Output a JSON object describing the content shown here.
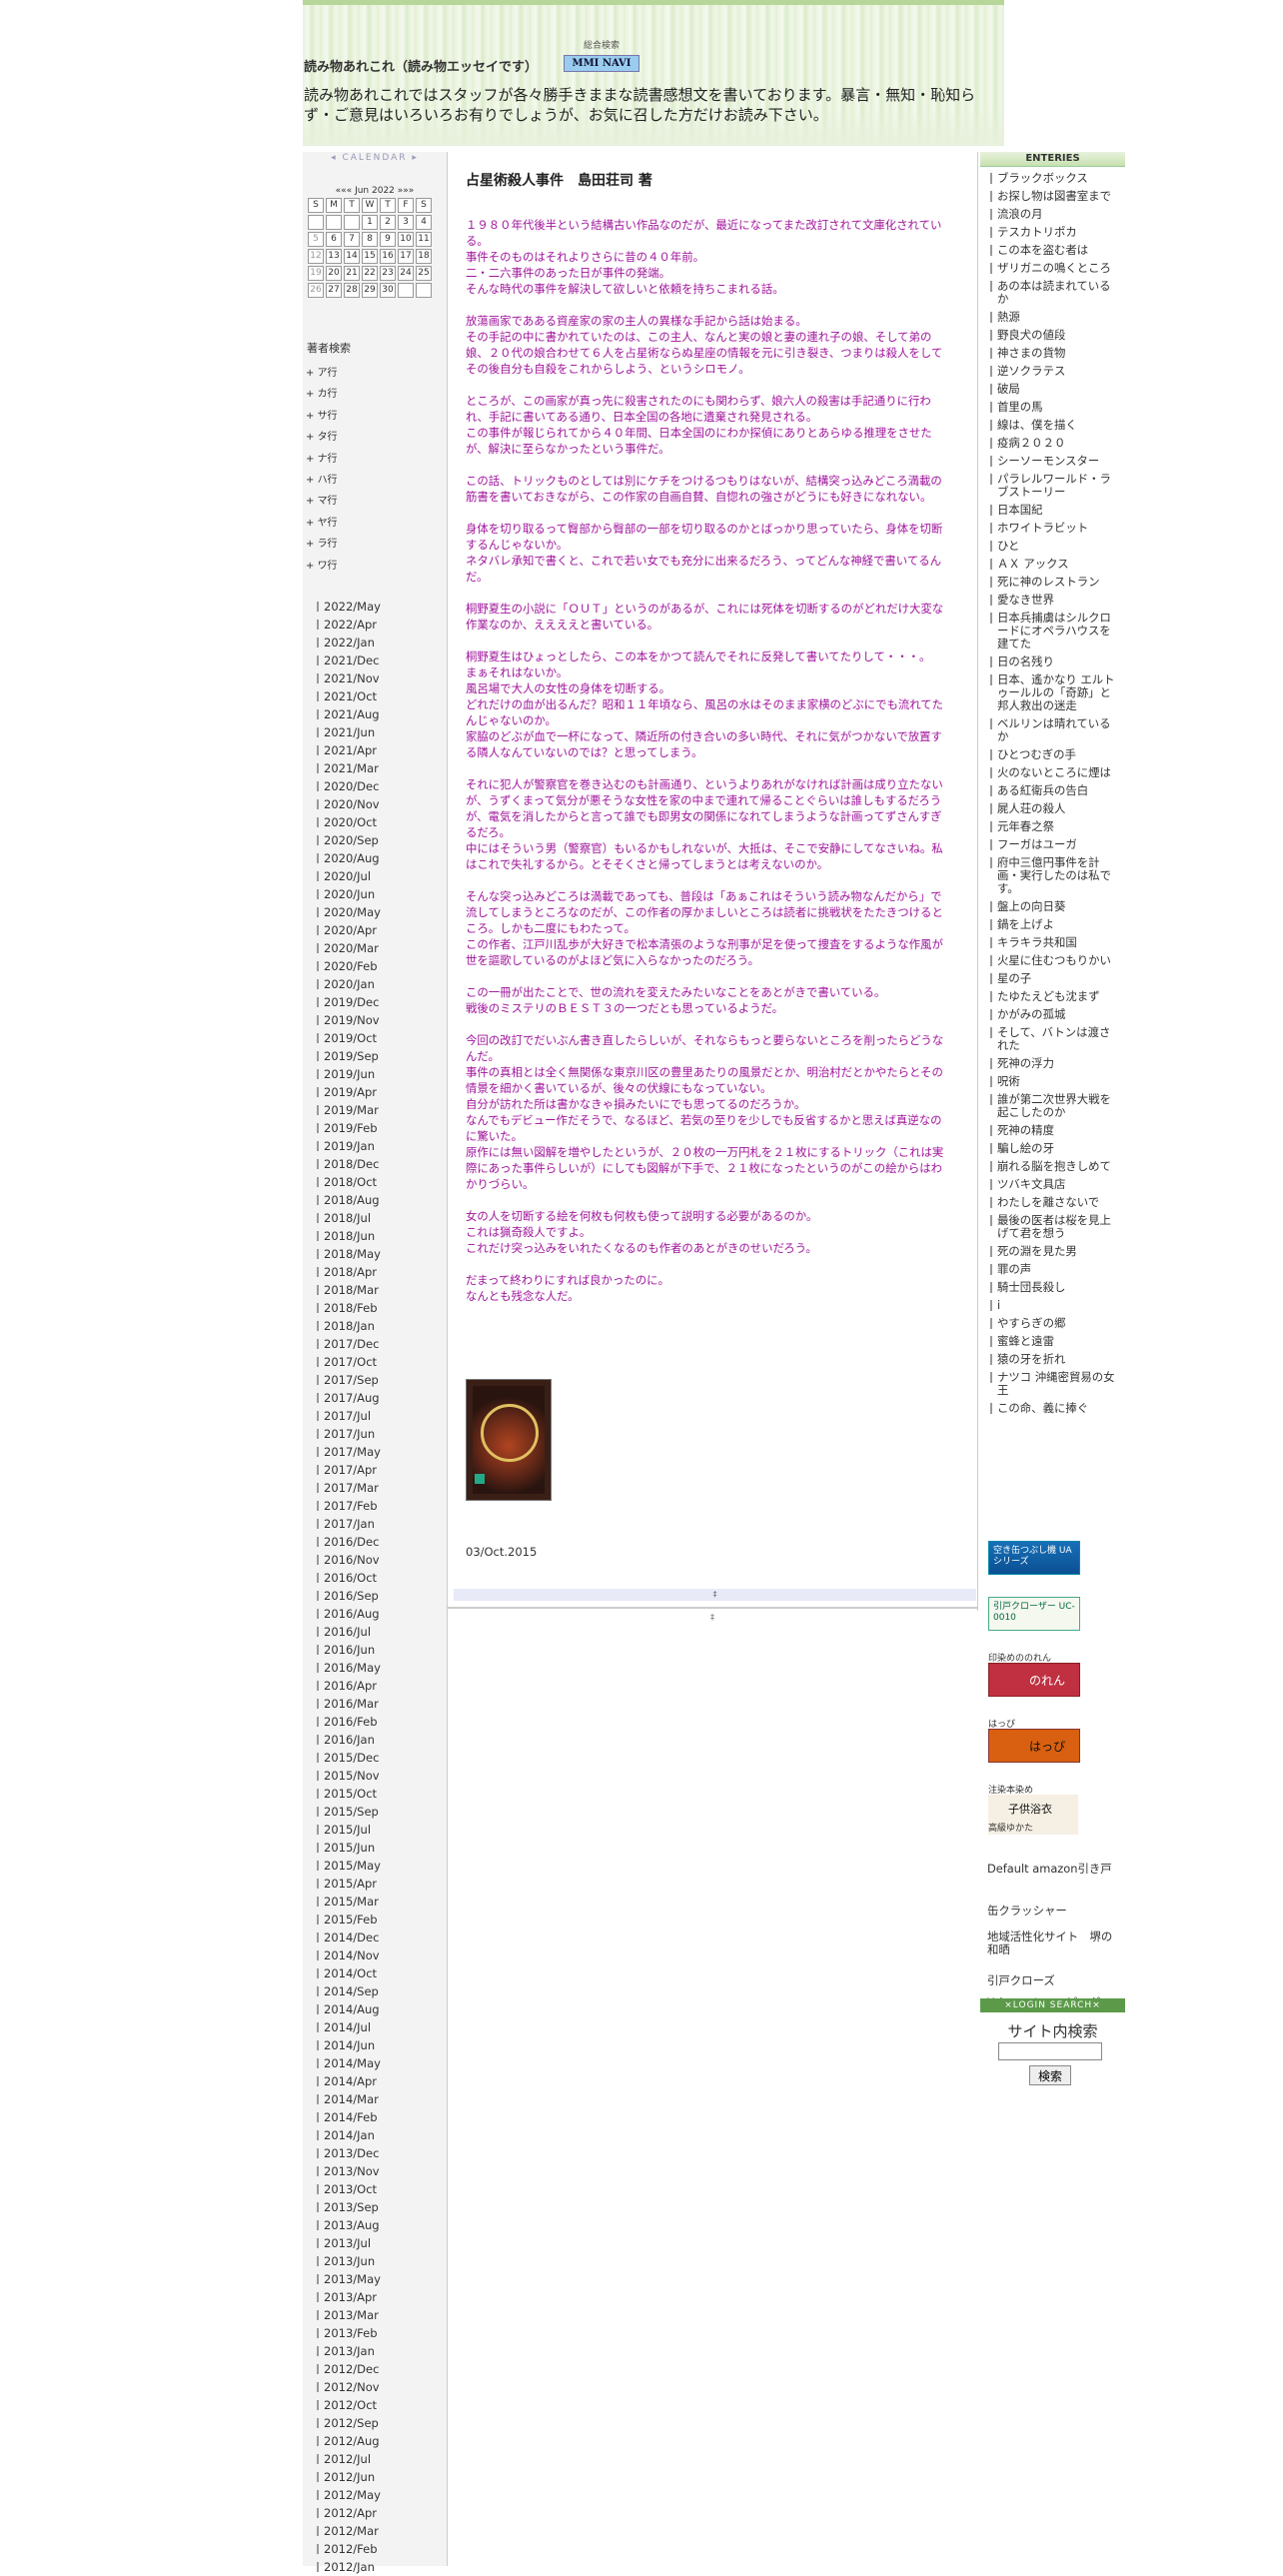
{
  "header": {
    "site_title": "読み物あれこれ（読み物エッセイです）",
    "nav_label": "総合検索",
    "nav_button": "MMI NAVI",
    "description": "読み物あれこれではスタッフが各々勝手きままな読書感想文を書いております。暴言・無知・恥知らず・ご意見はいろいろお有りでしょうが、お気に召した方だけお読み下さい。"
  },
  "calendar": {
    "heading": "CALENDAR",
    "month_label": "Jun 2022",
    "weekdays": [
      "S",
      "M",
      "T",
      "W",
      "T",
      "F",
      "S"
    ],
    "weeks": [
      [
        "",
        "",
        "",
        "1",
        "2",
        "3",
        "4"
      ],
      [
        "5",
        "6",
        "7",
        "8",
        "9",
        "10",
        "11"
      ],
      [
        "12",
        "13",
        "14",
        "15",
        "16",
        "17",
        "18"
      ],
      [
        "19",
        "20",
        "21",
        "22",
        "23",
        "24",
        "25"
      ],
      [
        "26",
        "27",
        "28",
        "29",
        "30",
        "",
        ""
      ]
    ]
  },
  "authors": {
    "heading": "著者検索",
    "groups": [
      "ア行",
      "カ行",
      "サ行",
      "タ行",
      "ナ行",
      "ハ行",
      "マ行",
      "ヤ行",
      "ラ行",
      "ワ行"
    ]
  },
  "archive": [
    "2022/May",
    "2022/Apr",
    "2022/Jan",
    "2021/Dec",
    "2021/Nov",
    "2021/Oct",
    "2021/Aug",
    "2021/Jun",
    "2021/Apr",
    "2021/Mar",
    "2020/Dec",
    "2020/Nov",
    "2020/Oct",
    "2020/Sep",
    "2020/Aug",
    "2020/Jul",
    "2020/Jun",
    "2020/May",
    "2020/Apr",
    "2020/Mar",
    "2020/Feb",
    "2020/Jan",
    "2019/Dec",
    "2019/Nov",
    "2019/Oct",
    "2019/Sep",
    "2019/Jun",
    "2019/Apr",
    "2019/Mar",
    "2019/Feb",
    "2019/Jan",
    "2018/Dec",
    "2018/Oct",
    "2018/Aug",
    "2018/Jul",
    "2018/Jun",
    "2018/May",
    "2018/Apr",
    "2018/Mar",
    "2018/Feb",
    "2018/Jan",
    "2017/Dec",
    "2017/Oct",
    "2017/Sep",
    "2017/Aug",
    "2017/Jul",
    "2017/Jun",
    "2017/May",
    "2017/Apr",
    "2017/Mar",
    "2017/Feb",
    "2017/Jan",
    "2016/Dec",
    "2016/Nov",
    "2016/Oct",
    "2016/Sep",
    "2016/Aug",
    "2016/Jul",
    "2016/Jun",
    "2016/May",
    "2016/Apr",
    "2016/Mar",
    "2016/Feb",
    "2016/Jan",
    "2015/Dec",
    "2015/Nov",
    "2015/Oct",
    "2015/Sep",
    "2015/Jul",
    "2015/Jun",
    "2015/May",
    "2015/Apr",
    "2015/Mar",
    "2015/Feb",
    "2014/Dec",
    "2014/Nov",
    "2014/Oct",
    "2014/Sep",
    "2014/Aug",
    "2014/Jul",
    "2014/Jun",
    "2014/May",
    "2014/Apr",
    "2014/Mar",
    "2014/Feb",
    "2014/Jan",
    "2013/Dec",
    "2013/Nov",
    "2013/Oct",
    "2013/Sep",
    "2013/Aug",
    "2013/Jul",
    "2013/Jun",
    "2013/May",
    "2013/Apr",
    "2013/Mar",
    "2013/Feb",
    "2013/Jan",
    "2012/Dec",
    "2012/Nov",
    "2012/Oct",
    "2012/Sep",
    "2012/Aug",
    "2012/Jul",
    "2012/Jun",
    "2012/May",
    "2012/Apr",
    "2012/Mar",
    "2012/Feb",
    "2012/Jan"
  ],
  "post": {
    "title": "占星術殺人事件　島田荘司 著",
    "paragraphs": [
      "１９８０年代後半という結構古い作品なのだが、最近になってまた改訂されて文庫化されている。\n事件そのものはそれよりさらに昔の４０年前。\n二・二六事件のあった日が事件の発端。\nそんな時代の事件を解決して欲しいと依頼を持ちこまれる話。",
      "放蕩画家であある資産家の家の主人の異様な手記から話は始まる。\nその手記の中に書かれていたのは、この主人、なんと実の娘と妻の連れ子の娘、そして弟の娘、２０代の娘合わせて６人を占星術ならぬ星座の情報を元に引き裂き、つまりは殺人をしてその後自分も自殺をこれからしよう、というシロモノ。",
      "ところが、この画家が真っ先に殺害されたのにも関わらず、娘六人の殺害は手記通りに行われ、手記に書いてある通り、日本全国の各地に遺棄され発見される。\nこの事件が報じられてから４０年間、日本全国のにわか探偵にありとあらゆる推理をさせたが、解決に至らなかったという事件だ。",
      "この話、トリックものとしては別にケチをつけるつもりはないが、結構突っ込みどころ満載の筋書を書いておきながら、この作家の自画自賛、自惚れの強さがどうにも好きになれない。",
      "身体を切り取るって臀部から臀部の一部を切り取るのかとばっかり思っていたら、身体を切断するんじゃないか。\nネタバレ承知で書くと、これで若い女でも充分に出来るだろう、ってどんな神経で書いてるんだ。",
      "桐野夏生の小説に「ＯＵＴ」というのがあるが、これには死体を切断するのがどれだけ大変な作業なのか、ええええと書いている。",
      "桐野夏生はひょっとしたら、この本をかつて読んでそれに反発して書いてたりして・・・。\nまぁそれはないか。\n風呂場で大人の女性の身体を切断する。\nどれだけの血が出るんだ？昭和１１年頃なら、風呂の水はそのまま家横のどぶにでも流れてたんじゃないのか。\n家脇のどぶが血で一杯になって、隣近所の付き合いの多い時代、それに気がつかないで放置する隣人なんていないのでは？と思ってしまう。",
      "それに犯人が警察官を巻き込むのも計画通り、というよりあれがなければ計画は成り立たないが、うずくまって気分が悪そうな女性を家の中まで連れて帰ることぐらいは誰しもするだろうが、電気を消したからと言って誰でも即男女の関係になれてしまうような計画ってずさんすぎるだろ。\n中にはそういう男（警察官）もいるかもしれないが、大抵は、そこで安静にしてなさいね。私はこれで失礼するから。とそそくさと帰ってしまうとは考えないのか。",
      "そんな突っ込みどころは満載であっても、普段は「あぁこれはそういう読み物なんだから」で流してしまうところなのだが、この作者の厚かましいところは読者に挑戦状をたたきつけるところ。しかも二度にもわたって。\nこの作者、江戸川乱歩が大好きで松本清張のような刑事が足を使って捜査をするような作風が世を謳歌しているのがよほど気に入らなかったのだろう。",
      "この一冊が出たことで、世の流れを変えたみたいなことをあとがきで書いている。\n戦後のミステリのＢＥＳＴ３の一つだとも思っているようだ。",
      "今回の改訂でだいぶん書き直したらしいが、それならもっと要らないところを削ったらどうなんだ。\n事件の真相とは全く無関係な東京川区の豊里あたりの風景だとか、明治村だとかやたらとその情景を細かく書いているが、後々の伏線にもなっていない。\n自分が訪れた所は書かなきゃ損みたいにでも思ってるのだろうか。\nなんでもデビュー作だそうで、なるほど、若気の至りを少しでも反省するかと思えば真逆なのに驚いた。\n原作には無い図解を増やしたというが、２０枚の一万円札を２１枚にするトリック（これは実際にあった事件らしいが）にしても図解が下手で、２１枚になったというのがこの絵からはわかりづらい。",
      "女の人を切断する絵を何枚も何枚も使って説明する必要があるのか。\nこれは猟奇殺人ですよ。\nこれだけ突っ込みをいれたくなるのも作者のあとがきのせいだろう。",
      "だまって終わりにすれば良かったのに。\nなんとも残念な人だ。"
    ],
    "date": "03/Oct.2015",
    "footer_mark": "‡"
  },
  "entries": {
    "heading": "ENTERIES",
    "items": [
      "ブラックボックス",
      "お探し物は図書室まで",
      "流浪の月",
      "テスカトリポカ",
      "この本を盗む者は",
      "ザリガニの鳴くところ",
      "あの本は読まれているか",
      "熱源",
      "野良犬の値段",
      "神さまの貨物",
      "逆ソクラテス",
      "破局",
      "首里の馬",
      "線は、僕を描く",
      "疫病２０２０",
      "シーソーモンスター",
      "パラレルワールド・ラブストーリー",
      "日本国紀",
      "ホワイトラビット",
      "ひと",
      "ＡＸ アックス",
      "死に神のレストラン",
      "愛なき世界",
      "日本兵捕虜はシルクロードにオペラハウスを建てた",
      "日の名残り",
      "日本、遙かなり エルトゥールルの「奇跡」と邦人救出の迷走",
      "ベルリンは晴れているか",
      "ひとつむぎの手",
      "火のないところに煙は",
      "ある紅衛兵の告白",
      "屍人荘の殺人",
      "元年春之祭",
      "フーガはユーガ",
      "府中三億円事件を計画・実行したのは私です。",
      "盤上の向日葵",
      "鍋を上げよ",
      "キラキラ共和国",
      "火星に住むつもりかい",
      "星の子",
      "たゆたえども沈まず",
      "かがみの孤城",
      "そして、バトンは渡された",
      "死神の浮力",
      "呪術",
      "誰が第二次世界大戦を起こしたのか",
      "死神の精度",
      "騙し絵の牙",
      "崩れる脳を抱きしめて",
      "ツバキ文具店",
      "わたしを離さないで",
      "最後の医者は桜を見上げて君を想う",
      "死の淵を見た男",
      "罪の声",
      "騎士団長殺し",
      "i",
      "やすらぎの郷",
      "蜜蜂と遠雷",
      "猿の牙を折れ",
      "ナツコ 沖縄密貿易の女王",
      "この命、義に捧ぐ"
    ]
  },
  "banners": [
    {
      "title": "",
      "text": "空き缶つぶし機 UAシリーズ"
    },
    {
      "title": "",
      "text": "引戸クローザー UC-0010"
    },
    {
      "title": "印染めののれん",
      "text": "のれん"
    },
    {
      "title": "はっぴ",
      "text": "はっぴ"
    },
    {
      "title": "注染本染め",
      "text": "子供浴衣",
      "sub": "高級ゆかた"
    }
  ],
  "links": [
    "Default amazon引き戸",
    "缶クラッシャー",
    "地域活性化サイト　堺の和晒",
    "引戸クローズ",
    "Yahoo　ショッピング"
  ],
  "search": {
    "login_bar": "×LOGIN SEARCH×",
    "title": "サイト内検索",
    "button": "検索"
  }
}
